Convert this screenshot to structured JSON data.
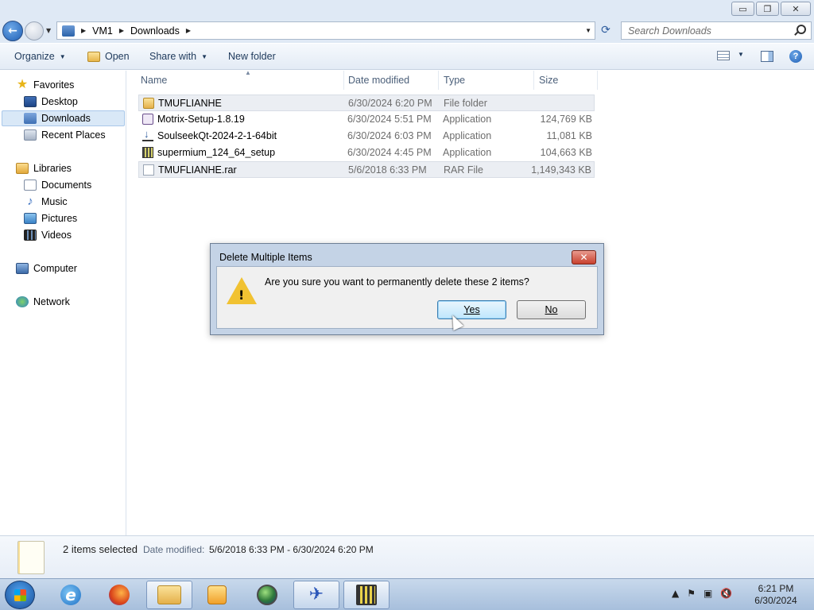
{
  "window": {
    "controls": {
      "minimize": "▭",
      "maximize": "❐",
      "close": "✕"
    }
  },
  "address": {
    "breadcrumbs": [
      "VM1",
      "Downloads"
    ],
    "search_placeholder": "Search Downloads"
  },
  "toolbar": {
    "organize": "Organize",
    "open": "Open",
    "share_with": "Share with",
    "new_folder": "New folder"
  },
  "sidebar": {
    "favorites": "Favorites",
    "desktop": "Desktop",
    "downloads": "Downloads",
    "recent": "Recent Places",
    "libraries": "Libraries",
    "documents": "Documents",
    "music": "Music",
    "pictures": "Pictures",
    "videos": "Videos",
    "computer": "Computer",
    "network": "Network"
  },
  "columns": {
    "name": "Name",
    "date": "Date modified",
    "type": "Type",
    "size": "Size"
  },
  "files": [
    {
      "name": "TMUFLIANHE",
      "date": "6/30/2024 6:20 PM",
      "type": "File folder",
      "size": "",
      "icon": "folder-icon",
      "selected": true
    },
    {
      "name": "Motrix-Setup-1.8.19",
      "date": "6/30/2024 5:51 PM",
      "type": "Application",
      "size": "124,769 KB",
      "icon": "installer-icon",
      "selected": false
    },
    {
      "name": "SoulseekQt-2024-2-1-64bit",
      "date": "6/30/2024 6:03 PM",
      "type": "Application",
      "size": "11,081 KB",
      "icon": "installer-icon",
      "selected": false
    },
    {
      "name": "supermium_124_64_setup",
      "date": "6/30/2024 4:45 PM",
      "type": "Application",
      "size": "104,663 KB",
      "icon": "installer-icon",
      "selected": false
    },
    {
      "name": "TMUFLIANHE.rar",
      "date": "5/6/2018 6:33 PM",
      "type": "RAR File",
      "size": "1,149,343 KB",
      "icon": "file-icon",
      "selected": true
    }
  ],
  "details": {
    "count": "2 items selected",
    "date_label": "Date modified:",
    "date_value": "5/6/2018 6:33 PM - 6/30/2024 6:20 PM"
  },
  "dialog": {
    "title": "Delete Multiple Items",
    "message": "Are you sure you want to permanently delete these 2 items?",
    "yes": "Yes",
    "no": "No"
  },
  "taskbar": {
    "clock_time": "6:21 PM",
    "clock_date": "6/30/2024"
  }
}
